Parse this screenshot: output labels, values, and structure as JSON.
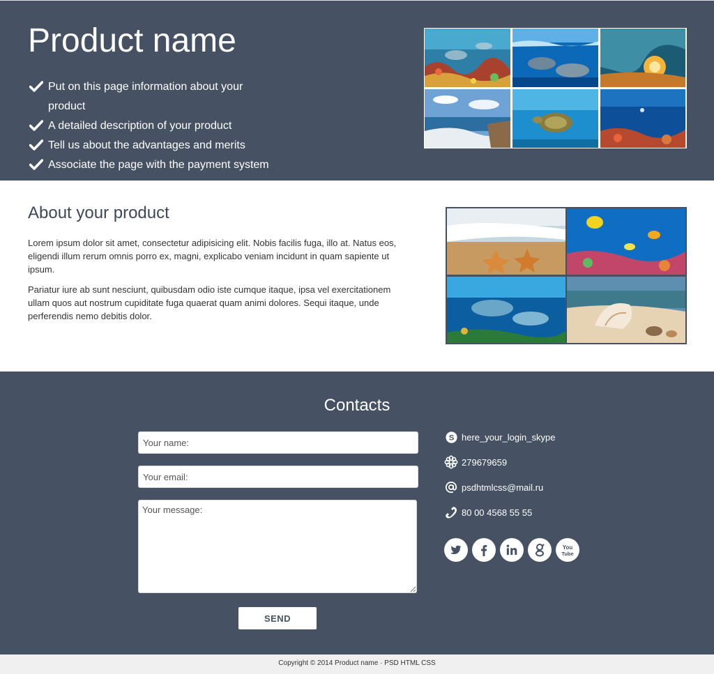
{
  "hero": {
    "title": "Product name",
    "features": [
      "Put on this page information about your product",
      "A detailed description of your product",
      "Tell us about the advantages and merits",
      "Associate the page with the payment system"
    ]
  },
  "about": {
    "title": "About your product",
    "paragraphs": [
      "Lorem ipsum dolor sit amet, consectetur adipisicing elit. Nobis facilis fuga, illo at. Natus eos, eligendi illum rerum omnis porro ex, magni, explicabo veniam incidunt in quam sapiente ut ipsum.",
      "Pariatur iure ab sunt nesciunt, quibusdam odio iste cumque itaque, ipsa vel exercitationem ullam quos aut nostrum cupiditate fuga quaerat quam animi dolores. Sequi itaque, unde perferendis nemo debitis dolor."
    ]
  },
  "contacts": {
    "title": "Contacts",
    "form": {
      "name_placeholder": "Your name:",
      "email_placeholder": "Your email:",
      "message_placeholder": "Your message:",
      "send_label": "SEND"
    },
    "skype": "here_your_login_skype",
    "icq": "279679659",
    "email": "psdhtmlcss@mail.ru",
    "phone": "80 00 4568 55 55",
    "socials": {
      "twitter": "twitter-icon",
      "facebook": "facebook-icon",
      "linkedin": "linkedin-icon",
      "google": "google-icon",
      "youtube": "youtube-icon",
      "youtube_top": "You",
      "youtube_bottom": "Tube"
    }
  },
  "footer": {
    "copyright": "Copyright © 2014 Product name · PSD HTML CSS"
  },
  "colors": {
    "dark": "#465263",
    "white": "#ffffff",
    "footer_bg": "#f0f0f0"
  }
}
